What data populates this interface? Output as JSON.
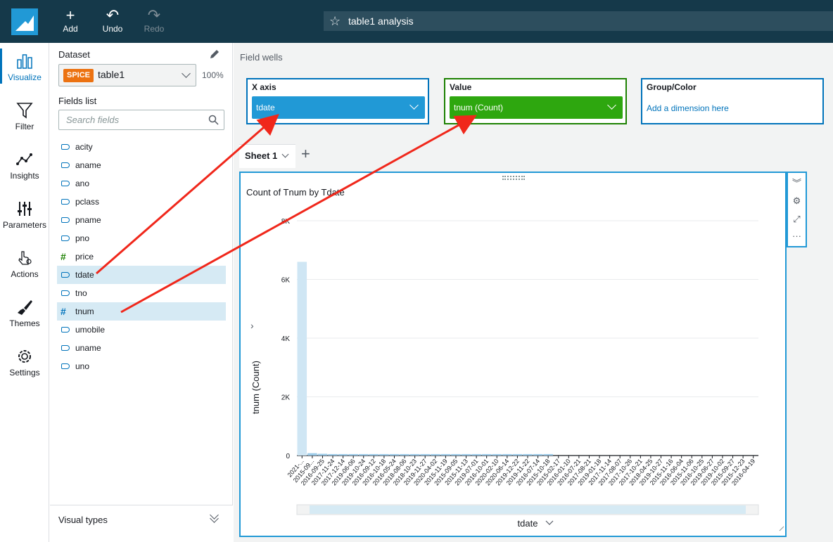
{
  "toolbar": {
    "add_label": "Add",
    "undo_label": "Undo",
    "redo_label": "Redo",
    "analysis_title": "table1 analysis"
  },
  "nav": [
    {
      "label": "Visualize",
      "icon": "bar-chart-icon",
      "active": true
    },
    {
      "label": "Filter",
      "icon": "filter-icon"
    },
    {
      "label": "Insights",
      "icon": "insights-icon"
    },
    {
      "label": "Parameters",
      "icon": "sliders-icon"
    },
    {
      "label": "Actions",
      "icon": "pointer-icon"
    },
    {
      "label": "Themes",
      "icon": "brush-icon"
    },
    {
      "label": "Settings",
      "icon": "gear-icon"
    }
  ],
  "panel": {
    "dataset_label": "Dataset",
    "spice_badge": "SPICE",
    "dataset_name": "table1",
    "dataset_percent": "100%",
    "fields_label": "Fields list",
    "search_placeholder": "Search fields",
    "visual_types_label": "Visual types",
    "fields": [
      {
        "name": "acity",
        "type": "dimension"
      },
      {
        "name": "aname",
        "type": "dimension"
      },
      {
        "name": "ano",
        "type": "dimension"
      },
      {
        "name": "pclass",
        "type": "dimension"
      },
      {
        "name": "pname",
        "type": "dimension"
      },
      {
        "name": "pno",
        "type": "dimension"
      },
      {
        "name": "price",
        "type": "measure"
      },
      {
        "name": "tdate",
        "type": "dimension",
        "selected": true
      },
      {
        "name": "tno",
        "type": "dimension"
      },
      {
        "name": "tnum",
        "type": "measure-dim",
        "selected": true
      },
      {
        "name": "umobile",
        "type": "dimension"
      },
      {
        "name": "uname",
        "type": "dimension"
      },
      {
        "name": "uno",
        "type": "dimension"
      }
    ]
  },
  "wells": {
    "heading": "Field wells",
    "x_axis_label": "X axis",
    "x_axis_value": "tdate",
    "value_label": "Value",
    "value_value": "tnum (Count)",
    "group_label": "Group/Color",
    "group_placeholder": "Add a dimension here"
  },
  "sheet": {
    "tab_label": "Sheet 1"
  },
  "chart_data": {
    "type": "bar",
    "title": "Count of Tnum by Tdate",
    "xlabel": "tdate",
    "ylabel": "tnum (Count)",
    "ylim": [
      0,
      8000
    ],
    "yticks": [
      "0",
      "2K",
      "4K",
      "6K",
      "8K"
    ],
    "categories": [
      "2021-...",
      "2015-09...",
      "2016-09-25",
      "2017-11-24",
      "2017-12-14",
      "2019-06-06",
      "2019-10-24",
      "2016-09-12",
      "2016-10-18",
      "2016-05-24",
      "2018-08-06",
      "2018-10-23",
      "2019-11-27",
      "2020-04-02",
      "2015-11-19",
      "2015-09-05",
      "2015-11-13",
      "2019-07-01",
      "2016-10-01",
      "2020-02-10",
      "2020-06-14",
      "2019-12-22",
      "2019-11-22",
      "2016-07-14",
      "2015-10-18",
      "2015-02-17",
      "2016-01-10",
      "2016-07-21",
      "2017-08-21",
      "2019-01-18",
      "2017-11-14",
      "2017-08-07",
      "2017-10-26",
      "2017-10-21",
      "2018-04-25",
      "2019-10-27",
      "2015-11-16",
      "2016-06-04",
      "2015-11-06",
      "2016-10-25",
      "2019-06-27",
      "2019-10-02",
      "2015-09-27",
      "2015-12-23",
      "2016-04-19"
    ],
    "values": [
      6600,
      80,
      60,
      50,
      50,
      50,
      50,
      50,
      50,
      50,
      50,
      50,
      50,
      50,
      50,
      50,
      50,
      50,
      50,
      50,
      50,
      50,
      50,
      50,
      50,
      0,
      0,
      0,
      0,
      0,
      0,
      0,
      0,
      0,
      0,
      0,
      0,
      0,
      0,
      0,
      0,
      0,
      0,
      0,
      0
    ]
  }
}
